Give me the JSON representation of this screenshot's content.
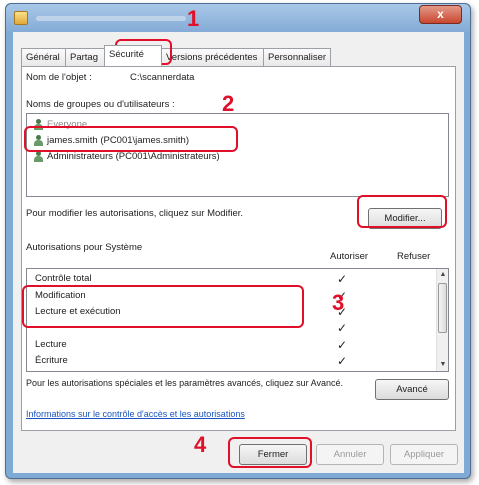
{
  "window": {
    "close_glyph": "x"
  },
  "tabs": [
    "Général",
    "Partag",
    "Sécurité",
    "Versions précédentes",
    "Personnaliser"
  ],
  "object_name": {
    "label": "Nom de l'objet :",
    "value": "C:\\scannerdata"
  },
  "groups": {
    "label": "Noms de groupes ou d'utilisateurs :",
    "items": [
      "Everyone",
      "james.smith (PC001\\james.smith)",
      "Administrateurs (PC001\\Administrateurs)"
    ]
  },
  "modify_hint": "Pour modifier les autorisations, cliquez sur Modifier.",
  "modify_button": "Modifier...",
  "permissions": {
    "title": "Autorisations pour Système",
    "col_allow": "Autoriser",
    "col_deny": "Refuser",
    "rows": [
      {
        "label": "Contrôle total",
        "allow": "✓"
      },
      {
        "label": "Modification",
        "allow": "✓"
      },
      {
        "label": "Lecture et exécution",
        "allow": "✓"
      },
      {
        "label": "",
        "allow": "✓"
      },
      {
        "label": "Lecture",
        "allow": "✓"
      },
      {
        "label": "Écriture",
        "allow": "✓"
      }
    ]
  },
  "advanced_hint": "Pour les autorisations spéciales et les paramètres avancés, cliquez sur Avancé.",
  "advanced_button": "Avancé",
  "help_link": "Informations sur le contrôle d'accès et les autorisations",
  "buttons": {
    "close": "Fermer",
    "cancel": "Annuler",
    "apply": "Appliquer"
  },
  "callouts": [
    "1",
    "2",
    "3",
    "4"
  ],
  "colors": {
    "highlight": "#e0102a",
    "title_bar": "#84acd6",
    "link": "#1a55c0"
  }
}
